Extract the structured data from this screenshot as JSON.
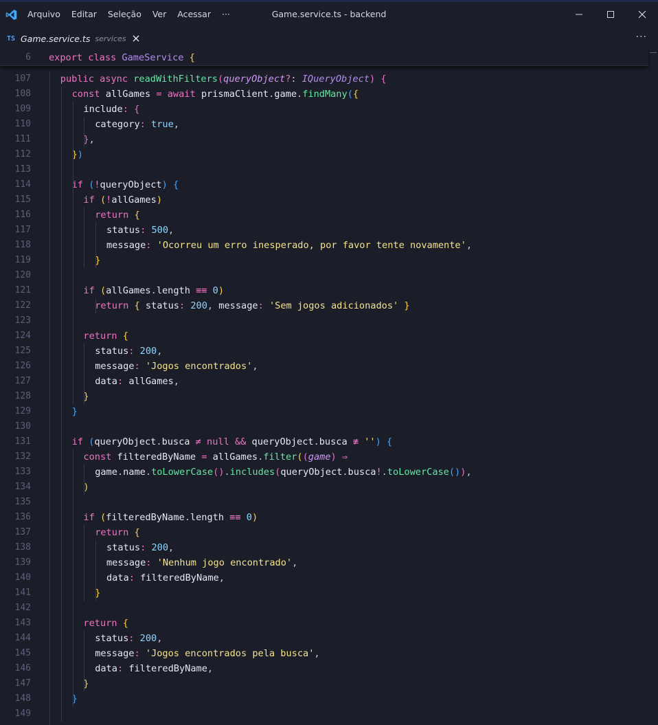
{
  "menu": [
    "Arquivo",
    "Editar",
    "Seleção",
    "Ver",
    "Acessar",
    "···"
  ],
  "window_title": "Game.service.ts - backend",
  "tab": {
    "badge": "TS",
    "name": "Game.service.ts",
    "description": "services"
  },
  "tabbar_more": "···",
  "sticky": {
    "line": "6",
    "parts": [
      [
        "kw",
        "export "
      ],
      [
        "kw",
        "class "
      ],
      [
        "cls",
        "GameService "
      ],
      [
        "b1",
        "{"
      ]
    ]
  },
  "lines": [
    {
      "n": "107",
      "indent": 1,
      "parts": [
        [
          "kw",
          "public "
        ],
        [
          "kw",
          "async "
        ],
        [
          "fn",
          "readWithFilters"
        ],
        [
          "b2",
          "("
        ],
        [
          "param",
          "queryObject"
        ],
        [
          "op",
          "?"
        ],
        [
          "punc",
          ": "
        ],
        [
          "typ",
          "IQueryObject"
        ],
        [
          "b2",
          ")"
        ],
        [
          "punc",
          " "
        ],
        [
          "b2",
          "{"
        ]
      ]
    },
    {
      "n": "108",
      "indent": 2,
      "parts": [
        [
          "kw",
          "const "
        ],
        [
          "id",
          "allGames "
        ],
        [
          "op",
          "= "
        ],
        [
          "kw",
          "await "
        ],
        [
          "id",
          "prismaClient"
        ],
        [
          "punc",
          "."
        ],
        [
          "id",
          "game"
        ],
        [
          "punc",
          "."
        ],
        [
          "fn",
          "findMany"
        ],
        [
          "b3",
          "("
        ],
        [
          "b1",
          "{"
        ]
      ]
    },
    {
      "n": "109",
      "indent": 3,
      "parts": [
        [
          "prop",
          "include"
        ],
        [
          "op",
          ": "
        ],
        [
          "b2",
          "{"
        ]
      ]
    },
    {
      "n": "110",
      "indent": 4,
      "parts": [
        [
          "prop",
          "category"
        ],
        [
          "op",
          ": "
        ],
        [
          "bool",
          "true"
        ],
        [
          "punc",
          ","
        ]
      ]
    },
    {
      "n": "111",
      "indent": 3,
      "parts": [
        [
          "b2",
          "}"
        ],
        [
          "punc",
          ","
        ]
      ]
    },
    {
      "n": "112",
      "indent": 2,
      "parts": [
        [
          "b1",
          "}"
        ],
        [
          "b3",
          ")"
        ]
      ]
    },
    {
      "n": "113",
      "indent": 0,
      "parts": []
    },
    {
      "n": "114",
      "indent": 2,
      "parts": [
        [
          "ctl",
          "if "
        ],
        [
          "b3",
          "("
        ],
        [
          "op",
          "!"
        ],
        [
          "id",
          "queryObject"
        ],
        [
          "b3",
          ")"
        ],
        [
          "punc",
          " "
        ],
        [
          "b3",
          "{"
        ]
      ]
    },
    {
      "n": "115",
      "indent": 3,
      "parts": [
        [
          "ctl",
          "if "
        ],
        [
          "b1",
          "("
        ],
        [
          "op",
          "!"
        ],
        [
          "id",
          "allGames"
        ],
        [
          "b1",
          ")"
        ]
      ]
    },
    {
      "n": "116",
      "indent": 4,
      "parts": [
        [
          "ctl",
          "return "
        ],
        [
          "b1",
          "{"
        ]
      ]
    },
    {
      "n": "117",
      "indent": 5,
      "parts": [
        [
          "prop",
          "status"
        ],
        [
          "op",
          ": "
        ],
        [
          "num",
          "500"
        ],
        [
          "punc",
          ","
        ]
      ]
    },
    {
      "n": "118",
      "indent": 5,
      "parts": [
        [
          "prop",
          "message"
        ],
        [
          "op",
          ": "
        ],
        [
          "str",
          "'Ocorreu um erro inesperado, por favor tente novamente'"
        ],
        [
          "punc",
          ","
        ]
      ]
    },
    {
      "n": "119",
      "indent": 4,
      "parts": [
        [
          "b1",
          "}"
        ]
      ]
    },
    {
      "n": "120",
      "indent": 0,
      "parts": []
    },
    {
      "n": "121",
      "indent": 3,
      "parts": [
        [
          "ctl",
          "if "
        ],
        [
          "b1",
          "("
        ],
        [
          "id",
          "allGames"
        ],
        [
          "punc",
          "."
        ],
        [
          "id",
          "length "
        ],
        [
          "op",
          "≡≡ "
        ],
        [
          "num",
          "0"
        ],
        [
          "b1",
          ")"
        ]
      ]
    },
    {
      "n": "122",
      "indent": 4,
      "parts": [
        [
          "ctl",
          "return "
        ],
        [
          "b1",
          "{ "
        ],
        [
          "prop",
          "status"
        ],
        [
          "op",
          ": "
        ],
        [
          "num",
          "200"
        ],
        [
          "punc",
          ", "
        ],
        [
          "prop",
          "message"
        ],
        [
          "op",
          ": "
        ],
        [
          "str",
          "'Sem jogos adicionados' "
        ],
        [
          "b1",
          "}"
        ]
      ]
    },
    {
      "n": "123",
      "indent": 0,
      "parts": []
    },
    {
      "n": "124",
      "indent": 3,
      "parts": [
        [
          "ctl",
          "return "
        ],
        [
          "b1",
          "{"
        ]
      ]
    },
    {
      "n": "125",
      "indent": 4,
      "parts": [
        [
          "prop",
          "status"
        ],
        [
          "op",
          ": "
        ],
        [
          "num",
          "200"
        ],
        [
          "punc",
          ","
        ]
      ]
    },
    {
      "n": "126",
      "indent": 4,
      "parts": [
        [
          "prop",
          "message"
        ],
        [
          "op",
          ": "
        ],
        [
          "str",
          "'Jogos encontrados'"
        ],
        [
          "punc",
          ","
        ]
      ]
    },
    {
      "n": "127",
      "indent": 4,
      "parts": [
        [
          "prop",
          "data"
        ],
        [
          "op",
          ": "
        ],
        [
          "id",
          "allGames"
        ],
        [
          "punc",
          ","
        ]
      ]
    },
    {
      "n": "128",
      "indent": 3,
      "parts": [
        [
          "b1",
          "}"
        ]
      ]
    },
    {
      "n": "129",
      "indent": 2,
      "parts": [
        [
          "b3",
          "}"
        ]
      ]
    },
    {
      "n": "130",
      "indent": 0,
      "parts": []
    },
    {
      "n": "131",
      "indent": 2,
      "parts": [
        [
          "ctl",
          "if "
        ],
        [
          "b3",
          "("
        ],
        [
          "id",
          "queryObject"
        ],
        [
          "punc",
          "."
        ],
        [
          "id",
          "busca "
        ],
        [
          "op",
          "≠ "
        ],
        [
          "kw",
          "null "
        ],
        [
          "op",
          "&& "
        ],
        [
          "id",
          "queryObject"
        ],
        [
          "punc",
          "."
        ],
        [
          "id",
          "busca "
        ],
        [
          "op",
          "≢ "
        ],
        [
          "str",
          "''"
        ],
        [
          "b3",
          ")"
        ],
        [
          "punc",
          " "
        ],
        [
          "b3",
          "{"
        ]
      ]
    },
    {
      "n": "132",
      "indent": 3,
      "parts": [
        [
          "kw",
          "const "
        ],
        [
          "id",
          "filteredByName "
        ],
        [
          "op",
          "= "
        ],
        [
          "id",
          "allGames"
        ],
        [
          "punc",
          "."
        ],
        [
          "fn",
          "filter"
        ],
        [
          "b1",
          "("
        ],
        [
          "b2",
          "("
        ],
        [
          "param",
          "game"
        ],
        [
          "b2",
          ")"
        ],
        [
          "punc",
          " "
        ],
        [
          "op",
          "⇒"
        ]
      ]
    },
    {
      "n": "133",
      "indent": 4,
      "parts": [
        [
          "id",
          "game"
        ],
        [
          "punc",
          "."
        ],
        [
          "id",
          "name"
        ],
        [
          "punc",
          "."
        ],
        [
          "fn",
          "toLowerCase"
        ],
        [
          "b2",
          "()"
        ],
        [
          "punc",
          "."
        ],
        [
          "fn",
          "includes"
        ],
        [
          "b2",
          "("
        ],
        [
          "id",
          "queryObject"
        ],
        [
          "punc",
          "."
        ],
        [
          "id",
          "busca"
        ],
        [
          "op",
          "!"
        ],
        [
          "punc",
          "."
        ],
        [
          "fn",
          "toLowerCase"
        ],
        [
          "b3",
          "()"
        ],
        [
          "b2",
          ")"
        ],
        [
          "punc",
          ","
        ]
      ]
    },
    {
      "n": "134",
      "indent": 3,
      "parts": [
        [
          "b1",
          ")"
        ]
      ]
    },
    {
      "n": "135",
      "indent": 0,
      "parts": []
    },
    {
      "n": "136",
      "indent": 3,
      "parts": [
        [
          "ctl",
          "if "
        ],
        [
          "b1",
          "("
        ],
        [
          "id",
          "filteredByName"
        ],
        [
          "punc",
          "."
        ],
        [
          "id",
          "length "
        ],
        [
          "op",
          "≡≡ "
        ],
        [
          "num",
          "0"
        ],
        [
          "b1",
          ")"
        ]
      ]
    },
    {
      "n": "137",
      "indent": 4,
      "parts": [
        [
          "ctl",
          "return "
        ],
        [
          "b1",
          "{"
        ]
      ]
    },
    {
      "n": "138",
      "indent": 5,
      "parts": [
        [
          "prop",
          "status"
        ],
        [
          "op",
          ": "
        ],
        [
          "num",
          "200"
        ],
        [
          "punc",
          ","
        ]
      ]
    },
    {
      "n": "139",
      "indent": 5,
      "parts": [
        [
          "prop",
          "message"
        ],
        [
          "op",
          ": "
        ],
        [
          "str",
          "'Nenhum jogo encontrado'"
        ],
        [
          "punc",
          ","
        ]
      ]
    },
    {
      "n": "140",
      "indent": 5,
      "parts": [
        [
          "prop",
          "data"
        ],
        [
          "op",
          ": "
        ],
        [
          "id",
          "filteredByName"
        ],
        [
          "punc",
          ","
        ]
      ]
    },
    {
      "n": "141",
      "indent": 4,
      "parts": [
        [
          "b1",
          "}"
        ]
      ]
    },
    {
      "n": "142",
      "indent": 0,
      "parts": []
    },
    {
      "n": "143",
      "indent": 3,
      "parts": [
        [
          "ctl",
          "return "
        ],
        [
          "b1",
          "{"
        ]
      ]
    },
    {
      "n": "144",
      "indent": 4,
      "parts": [
        [
          "prop",
          "status"
        ],
        [
          "op",
          ": "
        ],
        [
          "num",
          "200"
        ],
        [
          "punc",
          ","
        ]
      ]
    },
    {
      "n": "145",
      "indent": 4,
      "parts": [
        [
          "prop",
          "message"
        ],
        [
          "op",
          ": "
        ],
        [
          "str",
          "'Jogos encontrados pela busca'"
        ],
        [
          "punc",
          ","
        ]
      ]
    },
    {
      "n": "146",
      "indent": 4,
      "parts": [
        [
          "prop",
          "data"
        ],
        [
          "op",
          ": "
        ],
        [
          "id",
          "filteredByName"
        ],
        [
          "punc",
          ","
        ]
      ]
    },
    {
      "n": "147",
      "indent": 3,
      "parts": [
        [
          "b1",
          "}"
        ]
      ]
    },
    {
      "n": "148",
      "indent": 2,
      "parts": [
        [
          "b3",
          "}"
        ]
      ]
    },
    {
      "n": "149",
      "indent": 0,
      "parts": []
    }
  ]
}
